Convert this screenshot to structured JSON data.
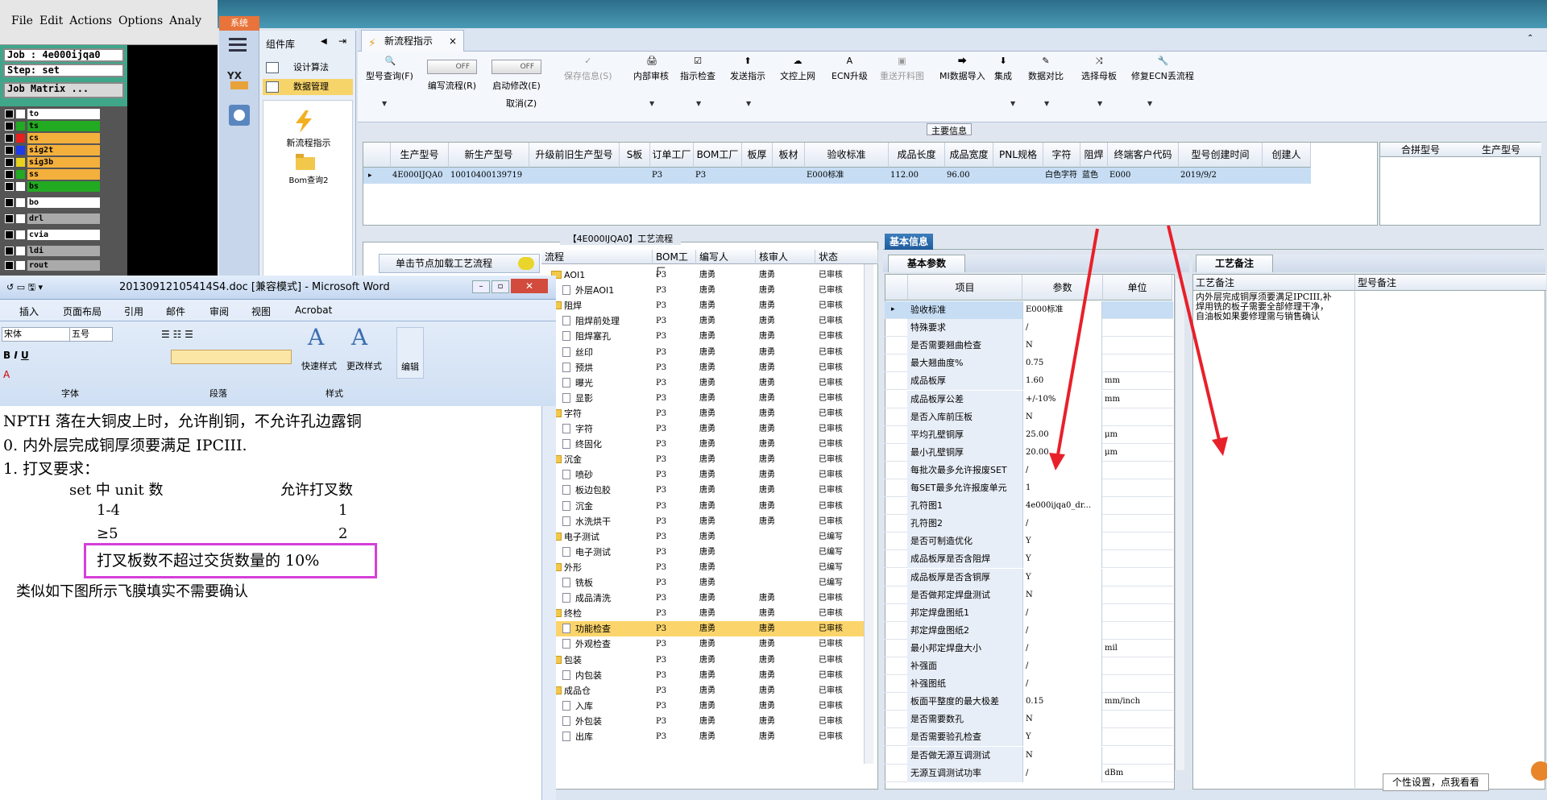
{
  "genesis": {
    "menu": [
      "File",
      "Edit",
      "Actions",
      "Options",
      "Analy"
    ],
    "job": "Job : 4e000ijqa0",
    "step": "Step: set",
    "matrix_btn": "Job Matrix ...",
    "layers": [
      {
        "name": "to",
        "color": "#ffffff",
        "bg": "#ffffff"
      },
      {
        "name": "ts",
        "color": "#22aa22",
        "bg": "#22aa22"
      },
      {
        "name": "cs",
        "color": "#e81f1f",
        "bg": "#f4b03c"
      },
      {
        "name": "sig2t",
        "color": "#1f3be8",
        "bg": "#f4b03c"
      },
      {
        "name": "sig3b",
        "color": "#e8d21f",
        "bg": "#f4b03c"
      },
      {
        "name": "ss",
        "color": "#22aa22",
        "bg": "#f4b03c"
      },
      {
        "name": "bs",
        "color": "#ffffff",
        "bg": "#22aa22"
      },
      {
        "name": "bo",
        "color": "#ffffff",
        "bg": "#ffffff"
      },
      {
        "name": "drl",
        "color": "#ffffff",
        "bg": "#aaaaaa"
      },
      {
        "name": "cvia",
        "color": "#ffffff",
        "bg": "#ffffff"
      },
      {
        "name": "ldi",
        "color": "#ffffff",
        "bg": "#aaaaaa"
      },
      {
        "name": "rout",
        "color": "#ffffff",
        "bg": "#aaaaaa"
      }
    ]
  },
  "app": {
    "sys_tab": "系统",
    "sidebar_title": "组件库",
    "sidebar_items": [
      "设计算法",
      "数据管理"
    ],
    "tools": [
      "新流程指示",
      "Bom查询2"
    ],
    "doc_tab": "新流程指示",
    "toolbar": [
      {
        "label": "型号查询(F)",
        "icon": "🔍",
        "dis": false
      },
      {
        "label": "编写流程(R)",
        "icon": "",
        "dis": false
      },
      {
        "label": "启动修改(E)",
        "icon": "",
        "dis": false
      },
      {
        "label": "保存信息(S)",
        "icon": "✓",
        "dis": true
      },
      {
        "label": "内部审核",
        "icon": "🖨",
        "dis": false
      },
      {
        "label": "指示检查",
        "icon": "☑",
        "dis": false
      },
      {
        "label": "发送指示",
        "icon": "⬆",
        "dis": false
      },
      {
        "label": "文控上网",
        "icon": "☁",
        "dis": false
      },
      {
        "label": "ECN升级",
        "icon": "A",
        "dis": false
      },
      {
        "label": "重送开料图",
        "icon": "▣",
        "dis": true
      },
      {
        "label": "MI数据导入",
        "icon": "⮕",
        "dis": false
      },
      {
        "label": "集成",
        "icon": "⬇",
        "dis": false
      },
      {
        "label": "数据对比",
        "icon": "✎",
        "dis": false
      },
      {
        "label": "选择母板",
        "icon": "⤨",
        "dis": false
      },
      {
        "label": "修复ECN丢流程",
        "icon": "🔧",
        "dis": false
      }
    ],
    "toggle_off": "OFF",
    "cancel_label": "取消(Z)",
    "main_info_title": "主要信息",
    "grid1": {
      "headers": [
        "生产型号",
        "新生产型号",
        "升级前旧生产型号",
        "S板",
        "订单工厂",
        "BOM工厂",
        "板厚",
        "板材",
        "验收标准",
        "成品长度",
        "成品宽度",
        "PNL规格",
        "字符",
        "阻焊",
        "终端客户代码",
        "型号创建时间",
        "创建人"
      ],
      "row": [
        "4E000IJQA0",
        "10010400139719",
        "",
        "",
        "P3",
        "P3",
        "",
        "",
        "E000标准",
        "112.00",
        "96.00",
        "",
        "白色字符",
        "蓝色",
        "E000",
        "2019/9/2",
        ""
      ]
    },
    "grid2_headers": [
      "合拼型号",
      "生产型号"
    ],
    "process_title": "【4E000IJQA0】工艺流程",
    "load_btn": "单击节点加载工艺流程",
    "tree_headers": [
      "流程",
      "BOM工厂",
      "编写人",
      "核审人",
      "状态"
    ],
    "tree": [
      {
        "name": "AOI1",
        "level": 0,
        "folder": true,
        "bom": "P3",
        "w": "唐勇",
        "a": "唐勇",
        "s": "已审核"
      },
      {
        "name": "外层AOI1",
        "level": 1,
        "folder": false,
        "bom": "P3",
        "w": "唐勇",
        "a": "唐勇",
        "s": "已审核"
      },
      {
        "name": "阻焊",
        "level": 0,
        "folder": true,
        "bom": "P3",
        "w": "唐勇",
        "a": "唐勇",
        "s": "已审核"
      },
      {
        "name": "阻焊前处理",
        "level": 1,
        "folder": false,
        "bom": "P3",
        "w": "唐勇",
        "a": "唐勇",
        "s": "已审核"
      },
      {
        "name": "阻焊塞孔",
        "level": 1,
        "folder": false,
        "bom": "P3",
        "w": "唐勇",
        "a": "唐勇",
        "s": "已审核"
      },
      {
        "name": "丝印",
        "level": 1,
        "folder": false,
        "bom": "P3",
        "w": "唐勇",
        "a": "唐勇",
        "s": "已审核"
      },
      {
        "name": "预烘",
        "level": 1,
        "folder": false,
        "bom": "P3",
        "w": "唐勇",
        "a": "唐勇",
        "s": "已审核"
      },
      {
        "name": "曝光",
        "level": 1,
        "folder": false,
        "bom": "P3",
        "w": "唐勇",
        "a": "唐勇",
        "s": "已审核"
      },
      {
        "name": "显影",
        "level": 1,
        "folder": false,
        "bom": "P3",
        "w": "唐勇",
        "a": "唐勇",
        "s": "已审核"
      },
      {
        "name": "字符",
        "level": 0,
        "folder": true,
        "bom": "P3",
        "w": "唐勇",
        "a": "唐勇",
        "s": "已审核"
      },
      {
        "name": "字符",
        "level": 1,
        "folder": false,
        "bom": "P3",
        "w": "唐勇",
        "a": "唐勇",
        "s": "已审核"
      },
      {
        "name": "终固化",
        "level": 1,
        "folder": false,
        "bom": "P3",
        "w": "唐勇",
        "a": "唐勇",
        "s": "已审核"
      },
      {
        "name": "沉金",
        "level": 0,
        "folder": true,
        "bom": "P3",
        "w": "唐勇",
        "a": "唐勇",
        "s": "已审核"
      },
      {
        "name": "喷砂",
        "level": 1,
        "folder": false,
        "bom": "P3",
        "w": "唐勇",
        "a": "唐勇",
        "s": "已审核"
      },
      {
        "name": "板边包胶",
        "level": 1,
        "folder": false,
        "bom": "P3",
        "w": "唐勇",
        "a": "唐勇",
        "s": "已审核"
      },
      {
        "name": "沉金",
        "level": 1,
        "folder": false,
        "bom": "P3",
        "w": "唐勇",
        "a": "唐勇",
        "s": "已审核"
      },
      {
        "name": "水洗烘干",
        "level": 1,
        "folder": false,
        "bom": "P3",
        "w": "唐勇",
        "a": "唐勇",
        "s": "已审核"
      },
      {
        "name": "电子测试",
        "level": 0,
        "folder": true,
        "bom": "P3",
        "w": "唐勇",
        "a": "",
        "s": "已编写"
      },
      {
        "name": "电子测试",
        "level": 1,
        "folder": false,
        "bom": "P3",
        "w": "唐勇",
        "a": "",
        "s": "已编写"
      },
      {
        "name": "外形",
        "level": 0,
        "folder": true,
        "bom": "P3",
        "w": "唐勇",
        "a": "",
        "s": "已编写"
      },
      {
        "name": "铣板",
        "level": 1,
        "folder": false,
        "bom": "P3",
        "w": "唐勇",
        "a": "",
        "s": "已编写"
      },
      {
        "name": "成品清洗",
        "level": 1,
        "folder": false,
        "bom": "P3",
        "w": "唐勇",
        "a": "唐勇",
        "s": "已审核"
      },
      {
        "name": "终检",
        "level": 0,
        "folder": true,
        "bom": "P3",
        "w": "唐勇",
        "a": "唐勇",
        "s": "已审核"
      },
      {
        "name": "功能检查",
        "level": 1,
        "folder": false,
        "bom": "P3",
        "w": "唐勇",
        "a": "唐勇",
        "s": "已审核",
        "sel": true
      },
      {
        "name": "外观检查",
        "level": 1,
        "folder": false,
        "bom": "P3",
        "w": "唐勇",
        "a": "唐勇",
        "s": "已审核"
      },
      {
        "name": "包装",
        "level": 0,
        "folder": true,
        "bom": "P3",
        "w": "唐勇",
        "a": "唐勇",
        "s": "已审核"
      },
      {
        "name": "内包装",
        "level": 1,
        "folder": false,
        "bom": "P3",
        "w": "唐勇",
        "a": "唐勇",
        "s": "已审核"
      },
      {
        "name": "成品仓",
        "level": 0,
        "folder": true,
        "bom": "P3",
        "w": "唐勇",
        "a": "唐勇",
        "s": "已审核"
      },
      {
        "name": "入库",
        "level": 1,
        "folder": false,
        "bom": "P3",
        "w": "唐勇",
        "a": "唐勇",
        "s": "已审核"
      },
      {
        "name": "外包装",
        "level": 1,
        "folder": false,
        "bom": "P3",
        "w": "唐勇",
        "a": "唐勇",
        "s": "已审核"
      },
      {
        "name": "出库",
        "level": 1,
        "folder": false,
        "bom": "P3",
        "w": "唐勇",
        "a": "唐勇",
        "s": "已审核"
      }
    ],
    "basic_info_tab": "基本信息",
    "basic_param_tab": "基本参数",
    "param_headers": [
      "项目",
      "参数",
      "单位"
    ],
    "params": [
      {
        "k": "验收标准",
        "v": "E000标准",
        "u": ""
      },
      {
        "k": "特殊要求",
        "v": "/",
        "u": ""
      },
      {
        "k": "是否需要翘曲检查",
        "v": "N",
        "u": ""
      },
      {
        "k": "最大翘曲度%",
        "v": "0.75",
        "u": ""
      },
      {
        "k": "成品板厚",
        "v": "1.60",
        "u": "mm"
      },
      {
        "k": "成品板厚公差",
        "v": "+/-10%",
        "u": "mm"
      },
      {
        "k": "是否入库前压板",
        "v": "N",
        "u": ""
      },
      {
        "k": "平均孔壁铜厚",
        "v": "25.00",
        "u": "μm"
      },
      {
        "k": "最小孔壁铜厚",
        "v": "20.00",
        "u": "μm"
      },
      {
        "k": "每批次最多允许报废SET",
        "v": "/",
        "u": ""
      },
      {
        "k": "每SET最多允许报废单元",
        "v": "1",
        "u": ""
      },
      {
        "k": "孔符图1",
        "v": "4e000ijqa0_dr...",
        "u": ""
      },
      {
        "k": "孔符图2",
        "v": "/",
        "u": ""
      },
      {
        "k": "是否可制造优化",
        "v": "Y",
        "u": ""
      },
      {
        "k": "成品板厚是否含阻焊",
        "v": "Y",
        "u": ""
      },
      {
        "k": "成品板厚是否含铜厚",
        "v": "Y",
        "u": ""
      },
      {
        "k": "是否做邦定焊盘测试",
        "v": "N",
        "u": ""
      },
      {
        "k": "邦定焊盘图纸1",
        "v": "/",
        "u": ""
      },
      {
        "k": "邦定焊盘图纸2",
        "v": "/",
        "u": ""
      },
      {
        "k": "最小邦定焊盘大小",
        "v": "/",
        "u": "mil"
      },
      {
        "k": "补强面",
        "v": "/",
        "u": ""
      },
      {
        "k": "补强图纸",
        "v": "/",
        "u": ""
      },
      {
        "k": "板面平整度的最大极差",
        "v": "0.15",
        "u": "mm/inch"
      },
      {
        "k": "是否需要数孔",
        "v": "N",
        "u": ""
      },
      {
        "k": "是否需要验孔检查",
        "v": "Y",
        "u": ""
      },
      {
        "k": "是否做无源互调测试",
        "v": "N",
        "u": ""
      },
      {
        "k": "无源互调测试功率",
        "v": "/",
        "u": "dBm"
      }
    ],
    "remark_tab": "工艺备注",
    "remark_col1": "工艺备注",
    "remark_col2": "型号备注",
    "remark_text": "内外层完成铜厚须要满足IPCIII,补焊用铣的板子需要全部修理干净，自油板如果要修理需与销售确认",
    "tooltip": "个性设置，点我看看"
  },
  "word": {
    "title": "20130912105414S4.doc [兼容模式] - Microsoft Word",
    "tabs": [
      "插入",
      "页面布局",
      "引用",
      "邮件",
      "审阅",
      "视图",
      "Acrobat"
    ],
    "font_name": "宋体",
    "font_size": "五号",
    "group_font": "字体",
    "group_para": "段落",
    "group_style": "样式",
    "quick_style": "快速样式",
    "change_style": "更改样式",
    "edit": "编辑",
    "lines": [
      "NPTH 落在大铜皮上时，允许削铜，不允许孔边露铜",
      "0. 内外层完成铜厚须要满足 IPCIII.",
      "1. 打叉要求：",
      "set 中 unit 数",
      "允许打叉数",
      "1-4",
      "1",
      "≥5",
      "2",
      "打叉板数不超过交货数量的 10%",
      "类似如下图所示飞膜填实不需要确认"
    ]
  }
}
